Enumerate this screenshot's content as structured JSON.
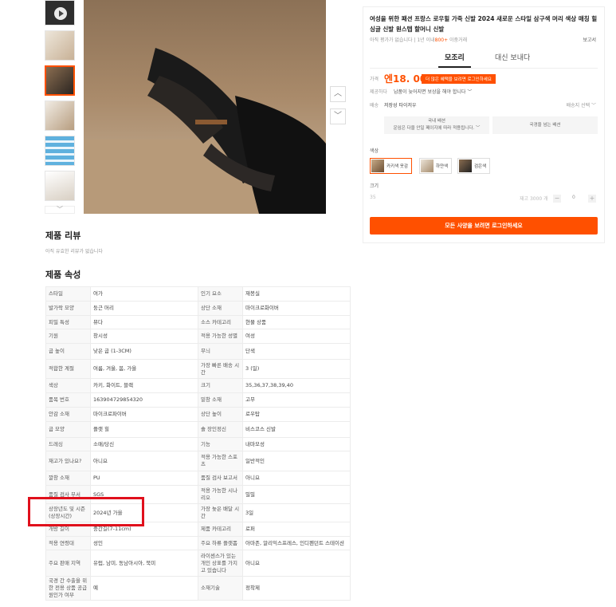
{
  "gallery": {
    "chevron_down": "﹀",
    "arrow_up": "︿",
    "arrow_down": "﹀"
  },
  "reviews": {
    "title": "제품 리뷰",
    "empty": "아직 유효한 리뷰가 없습니다"
  },
  "attributes": {
    "title": "제품 속성",
    "rows": [
      [
        "스타일",
        "여가",
        "인기 요소",
        "재봉실"
      ],
      [
        "발가락 모양",
        "둥근 머리",
        "상단 소재",
        "마이크로화이버"
      ],
      [
        "피밀 특성",
        "뮤다",
        "소스 카테고리",
        "현물 상품"
      ],
      [
        "기원",
        "창시성",
        "적용 가능한 성별",
        "여성"
      ],
      [
        "굽 높이",
        "낮은 굽 (1-3CM)",
        "무늬",
        "단색"
      ],
      [
        "적합한 계절",
        "여름, 겨울, 봄, 가을",
        "가장 빠른 배송 시간",
        "3 (일)"
      ],
      [
        "색상",
        "카키, 화이트, 블랙",
        "크기",
        "35,36,37,38,39,40"
      ],
      [
        "품목 번호",
        "163904729854320",
        "밑창 소재",
        "고무"
      ],
      [
        "안감 소재",
        "마이크로파이버",
        "상단 높이",
        "로우탑"
      ],
      [
        "굽 모양",
        "플랫 힐",
        "솔 장인정신",
        "비스코스 신발"
      ],
      [
        "드레싱",
        "소매/당신",
        "기능",
        "내마모성"
      ],
      [
        "재고가 있나요?",
        "아니요",
        "적용 가능한 스포츠",
        "일반적인"
      ],
      [
        "깔창 소재",
        "PU",
        "품질 검사 보고서",
        "아니요"
      ],
      [
        "품질 검사 부서",
        "SGS",
        "적용 가능한 시나리오",
        "밀밀"
      ],
      [
        "상장년도 및 시즌 (상장시간)",
        "2024년 가을",
        "가장 늦은 배달 시간",
        "3일"
      ],
      [
        "개방 길이",
        "중간길(7-11cm)",
        "제품 카테고리",
        "로퍼"
      ],
      [
        "적용 연령대",
        "성인",
        "주요 하류 플랫폼",
        "아마존, 알리익스프레스, 인디펜던트 스테이션"
      ],
      [
        "주요 판매 지역",
        "유럽, 남미, 동남아시아, 북미",
        "라이센스가 있는 개인 상표를 가지고 있습니다",
        "아니요"
      ],
      [
        "국경 간 수출을 위한 전용 상품 공급 원인가 여부",
        "예",
        "소재기술",
        "정착제"
      ]
    ]
  },
  "panel": {
    "title": "여성을 위한 패션 프랑스 로우힐 가죽 신발 2024 새로운 스타일 삼구색 머리 색상 매칭 힐 싱글 신발 원스텝 할머니 신발",
    "sub_prefix": "아직 평가가 없습니다 | 1년 이내",
    "sub_count": "800+",
    "sub_suffix": " 이중거래",
    "report": "보고서",
    "tab_active": "모조리",
    "tab_other": "대신 보내다",
    "price_label": "가격",
    "price": "엔18. 00",
    "price_badge": "더 많은 혜택을 보려면 로그인하세요",
    "guarantee_label": "제공하다",
    "guarantee_text": "납품이 늦어지면 보상을 해야 합니다 ﹀",
    "ship_label": "배송",
    "ship_from": "저장성 타이저우",
    "ship_select": "배송지 선택 ﹀",
    "box1_line1": "국내 배션",
    "box1_line2": "운임은 다을 안일 페이지에 따라 적용됩니다. ﹀",
    "box2": "국경을 넘는 배션",
    "color_label": "색상",
    "colors": [
      "카키색 옷감",
      "하얀색",
      "검은색"
    ],
    "size_label": "크기",
    "size_value": "35",
    "stock": "재고 3000 개",
    "qty": "0",
    "minus": "−",
    "plus": "+",
    "login_button": "모든 사양을 보려면 로그인하세요"
  },
  "colors": {
    "accent": "#ff5000",
    "highlight_box": "#e0101c"
  }
}
